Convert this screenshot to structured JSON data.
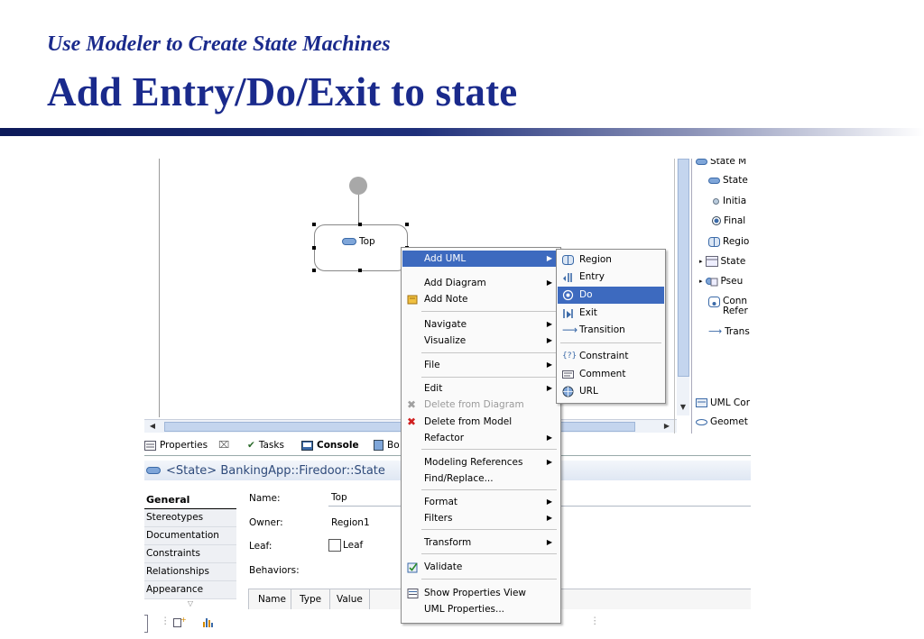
{
  "slide": {
    "subtitle": "Use Modeler to Create State Machines",
    "title": "Add Entry/Do/Exit to state"
  },
  "diagram": {
    "state_label": "Top"
  },
  "palette": {
    "items": [
      "State M",
      "State",
      "Initia",
      "Final",
      "Regio",
      "State",
      "Pseu",
      "Conn",
      "Refer",
      "Trans",
      "UML Cor",
      "Geomet"
    ]
  },
  "properties": {
    "tabs": [
      "Properties",
      "Tasks",
      "Console",
      "Bo"
    ],
    "header": "<State> BankingApp::Firedoor::State",
    "sidebar": [
      "General",
      "Stereotypes",
      "Documentation",
      "Constraints",
      "Relationships",
      "Appearance"
    ],
    "name_label": "Name:",
    "name_value": "Top",
    "owner_label": "Owner:",
    "owner_value": "Region1",
    "leaf_label": "Leaf:",
    "leaf_checkbox_label": "Leaf",
    "behaviors_label": "Behaviors:",
    "columns": [
      "Name",
      "Type",
      "Value"
    ]
  },
  "context_menu": {
    "items": [
      "Add UML",
      "Add Diagram",
      "Add Note",
      "Navigate",
      "Visualize",
      "File",
      "Edit",
      "Delete from Diagram",
      "Delete from Model",
      "Refactor",
      "Modeling References",
      "Find/Replace...",
      "Format",
      "Filters",
      "Transform",
      "Validate",
      "Show Properties View",
      "UML Properties..."
    ]
  },
  "submenu": {
    "items": [
      "Region",
      "Entry",
      "Do",
      "Exit",
      "Transition",
      "Constraint",
      "Comment",
      "URL"
    ]
  },
  "colors": {
    "title": "#1a2a8c",
    "selection": "#3d6abf"
  }
}
